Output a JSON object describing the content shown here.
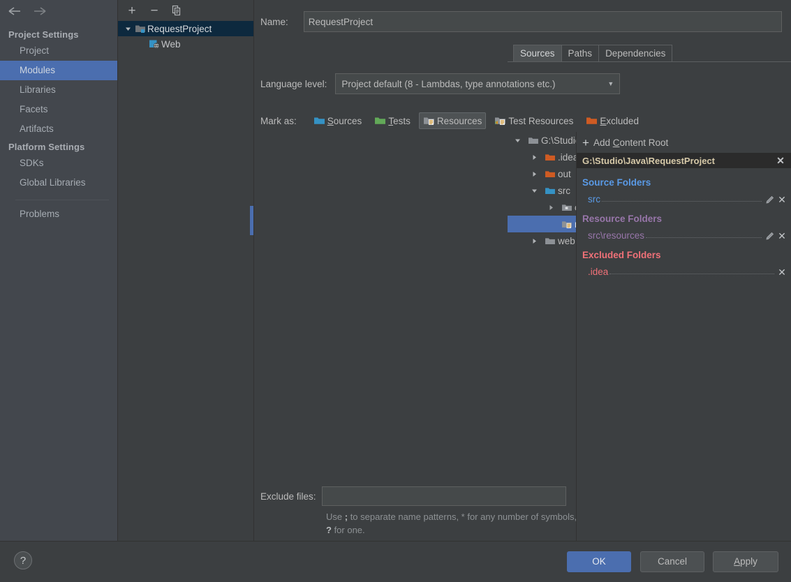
{
  "sidebar": {
    "nav": {
      "back_icon": "arrow-left-icon",
      "forward_icon": "arrow-right-icon"
    },
    "groups": [
      {
        "title": "Project Settings",
        "items": [
          {
            "label": "Project",
            "selected": false
          },
          {
            "label": "Modules",
            "selected": true
          },
          {
            "label": "Libraries",
            "selected": false
          },
          {
            "label": "Facets",
            "selected": false
          },
          {
            "label": "Artifacts",
            "selected": false
          }
        ]
      },
      {
        "title": "Platform Settings",
        "items": [
          {
            "label": "SDKs",
            "selected": false
          },
          {
            "label": "Global Libraries",
            "selected": false
          }
        ]
      }
    ],
    "problems_label": "Problems",
    "selected_color": "#4b6eaf"
  },
  "module_panel": {
    "toolbar": [
      {
        "name": "add-module-button",
        "glyph": "+"
      },
      {
        "name": "remove-module-button",
        "glyph": "−"
      },
      {
        "name": "copy-module-button",
        "glyph": "copy-icon"
      }
    ],
    "tree": [
      {
        "label": "RequestProject",
        "icon": "module-folder-icon",
        "expanded": true,
        "selected": true,
        "depth": 0
      },
      {
        "label": "Web",
        "icon": "web-facet-icon",
        "expanded": null,
        "selected": false,
        "depth": 1
      }
    ]
  },
  "center": {
    "name_label": "Name:",
    "name_value": "RequestProject",
    "tabs": [
      {
        "label": "Sources",
        "active": true
      },
      {
        "label": "Paths",
        "active": false
      },
      {
        "label": "Dependencies",
        "active": false
      }
    ],
    "language_level_label": "Language level:",
    "language_level_value": "Project default (8 - Lambdas, type annotations etc.)",
    "mark_as_label": "Mark as:",
    "mark_as_buttons": [
      {
        "label": "Sources",
        "mnemonic": "S",
        "icon": "folder-sources-icon",
        "color": "#3592c4",
        "active": false
      },
      {
        "label": "Tests",
        "mnemonic": "T",
        "icon": "folder-tests-icon",
        "color": "#62a958",
        "active": false
      },
      {
        "label": "Resources",
        "mnemonic": "",
        "icon": "folder-resources-icon",
        "color": "#9b9fa3",
        "active": true
      },
      {
        "label": "Test Resources",
        "mnemonic": "",
        "icon": "folder-test-resources-icon",
        "color": "#9b9fa3",
        "active": false
      },
      {
        "label": "Excluded",
        "mnemonic": "E",
        "icon": "folder-excluded-icon",
        "color": "#cf5b23",
        "active": false
      }
    ],
    "tree": [
      {
        "label": "G:\\Studio\\Java\\RequestProject",
        "depth": 0,
        "state": "expanded",
        "icon": "folder-icon",
        "color": "#9b9fa3",
        "selected": false
      },
      {
        "label": ".idea",
        "depth": 1,
        "state": "collapsed",
        "icon": "folder-excluded-icon",
        "color": "#cf5b23",
        "selected": false
      },
      {
        "label": "out",
        "depth": 1,
        "state": "collapsed",
        "icon": "folder-excluded-icon",
        "color": "#cf5b23",
        "selected": false
      },
      {
        "label": "src",
        "depth": 1,
        "state": "expanded",
        "icon": "folder-sources-icon",
        "color": "#3592c4",
        "selected": false
      },
      {
        "label": "com",
        "depth": 2,
        "state": "collapsed",
        "icon": "folder-package-icon",
        "color": "#9b9fa3",
        "selected": false
      },
      {
        "label": "resources",
        "depth": 2,
        "state": "leaf",
        "icon": "folder-resources-icon",
        "color": "#9b9fa3",
        "selected": true
      },
      {
        "label": "web",
        "depth": 1,
        "state": "collapsed",
        "icon": "folder-icon",
        "color": "#9b9fa3",
        "selected": false
      }
    ],
    "exclude_files_label": "Exclude files:",
    "exclude_files_value": "",
    "exclude_hint_1": "Use ",
    "exclude_hint_semicolon": ";",
    "exclude_hint_2": " to separate name patterns, * for any number of symbols, ",
    "exclude_hint_question": "?",
    "exclude_hint_3": " for one."
  },
  "right_panel": {
    "add_content_root": "Add Content Root",
    "add_content_root_mnemonic": "C",
    "content_root_path": "G:\\Studio\\Java\\RequestProject",
    "groups": [
      {
        "title": "Source Folders",
        "kind": "src",
        "color": "#5a9ae6",
        "folders": [
          {
            "name": "src",
            "has_edit": true,
            "has_remove": true
          }
        ]
      },
      {
        "title": "Resource Folders",
        "kind": "res",
        "color": "#9876aa",
        "folders": [
          {
            "name": "src\\resources",
            "has_edit": true,
            "has_remove": true
          }
        ]
      },
      {
        "title": "Excluded Folders",
        "kind": "exc",
        "color": "#f07178",
        "folders": [
          {
            "name": ".idea",
            "has_edit": false,
            "has_remove": true
          }
        ]
      }
    ]
  },
  "bottom_bar": {
    "help_label": "?",
    "ok_label": "OK",
    "cancel_label": "Cancel",
    "apply_label": "Apply",
    "apply_mnemonic": "A",
    "ok_color": "#4b6eaf"
  }
}
